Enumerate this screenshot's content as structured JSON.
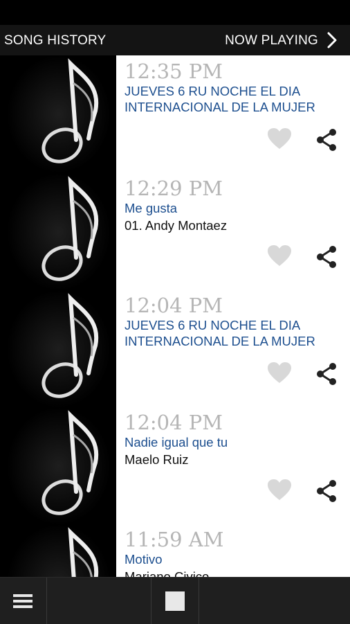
{
  "header": {
    "left_tab": "SONG HISTORY",
    "right_tab": "NOW PLAYING",
    "chevron_icon": "chevron-right-icon"
  },
  "history": [
    {
      "time": "12:35 PM",
      "title": "JUEVES 6 RU NOCHE EL DIA INTERNACIONAL DE LA MUJER",
      "artist": ""
    },
    {
      "time": "12:29 PM",
      "title": "Me gusta",
      "artist": "01. Andy Montaez"
    },
    {
      "time": "12:04 PM",
      "title": "JUEVES 6 RU NOCHE EL DIA INTERNACIONAL DE LA MUJER",
      "artist": ""
    },
    {
      "time": "12:04 PM",
      "title": "Nadie igual que tu",
      "artist": "Maelo Ruiz"
    },
    {
      "time": "11:59 AM",
      "title": "Motivo",
      "artist": "Mariano Civico"
    }
  ],
  "icons": {
    "heart": "heart-icon",
    "share": "share-icon",
    "menu": "menu-icon",
    "stop": "stop-icon",
    "art": "music-note-icon"
  },
  "colors": {
    "title": "#1d4f8f",
    "time": "#b5b5b5",
    "header_bg": "#141414",
    "bottom_bg": "#1f1f1f"
  }
}
